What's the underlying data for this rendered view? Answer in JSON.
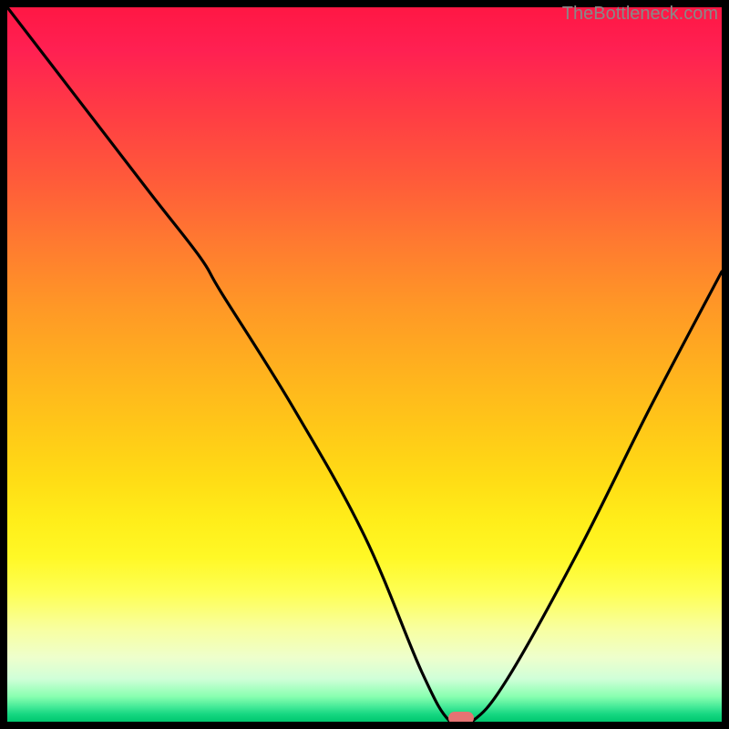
{
  "attribution": "TheBottleneck.com",
  "colors": {
    "background": "#000000",
    "curve": "#000000",
    "marker": "#e57373",
    "attribution_text": "#888888"
  },
  "chart_data": {
    "type": "line",
    "title": "",
    "xlabel": "",
    "ylabel": "",
    "xlim": [
      0,
      100
    ],
    "ylim": [
      0,
      100
    ],
    "description": "Bottleneck curve showing a V-shape valley; background gradient from red (high bottleneck) at top through orange/yellow to green (no bottleneck) at bottom. Minimum occurs near x≈63.",
    "series": [
      {
        "name": "bottleneck-curve",
        "x": [
          0,
          10,
          20,
          27,
          30,
          40,
          50,
          58,
          62,
          65,
          70,
          80,
          90,
          100
        ],
        "y": [
          100,
          87,
          74,
          65,
          60,
          44,
          26,
          7,
          0,
          0,
          6,
          24,
          44,
          63
        ]
      }
    ],
    "marker": {
      "x": 63.5,
      "y": 0
    },
    "gradient_stops": [
      {
        "pos": 0,
        "color": "#ff1744"
      },
      {
        "pos": 50,
        "color": "#ffc818"
      },
      {
        "pos": 80,
        "color": "#feff55"
      },
      {
        "pos": 100,
        "color": "#00c870"
      }
    ]
  }
}
